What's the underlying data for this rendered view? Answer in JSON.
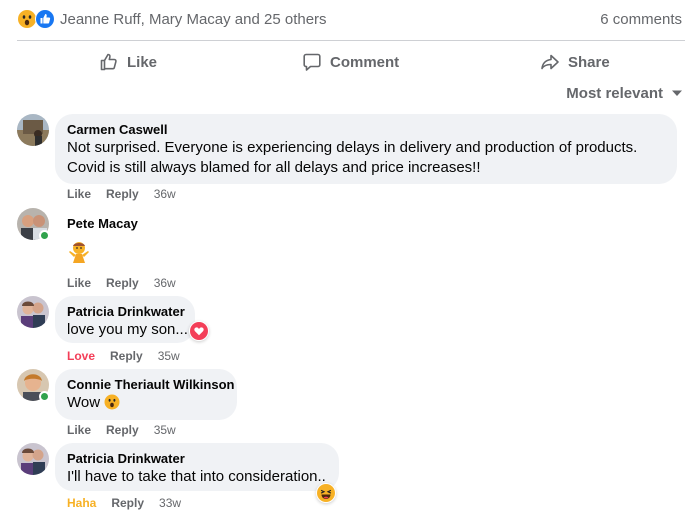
{
  "summary": {
    "reactors": "Jeanne Ruff, Mary Macay and 25 others",
    "comments_count": "6 comments",
    "reaction_icons": [
      "wow-icon",
      "like-icon"
    ]
  },
  "actions": {
    "like": "Like",
    "comment": "Comment",
    "share": "Share"
  },
  "sort": {
    "label": "Most relevant"
  },
  "colors": {
    "secondary_text": "#65676b",
    "bubble_bg": "#f0f2f5",
    "love": "#f33e58",
    "haha": "#f7b125",
    "online": "#31a24c",
    "like_blue": "#1877f2"
  },
  "comments": [
    {
      "author": "Carmen Caswell",
      "lines": [
        "Not surprised. Everyone is experiencing delays in delivery and production of products.",
        "Covid is still always blamed for all delays and price increases!!"
      ],
      "reaction_label": "Like",
      "reply": "Reply",
      "time": "36w",
      "online": false
    },
    {
      "author": "Pete Macay",
      "lines": [],
      "sticker": "person-shrugging-emoji",
      "reaction_label": "Like",
      "reply": "Reply",
      "time": "36w",
      "online": true
    },
    {
      "author": "Patricia Drinkwater",
      "lines": [
        "love you my son..."
      ],
      "badge": "love-reaction-icon",
      "reaction_label": "Love",
      "reply": "Reply",
      "time": "35w",
      "online": false
    },
    {
      "author": "Connie Theriault Wilkinson",
      "lines": [
        "Wow"
      ],
      "inline_emoji": "wow-emoji",
      "reaction_label": "Like",
      "reply": "Reply",
      "time": "35w",
      "online": true
    },
    {
      "author": "Patricia Drinkwater",
      "lines": [
        "I'll have to take that into consideration.."
      ],
      "badge": "haha-reaction-icon",
      "reaction_label": "Haha",
      "reply": "Reply",
      "time": "33w",
      "online": false
    }
  ]
}
